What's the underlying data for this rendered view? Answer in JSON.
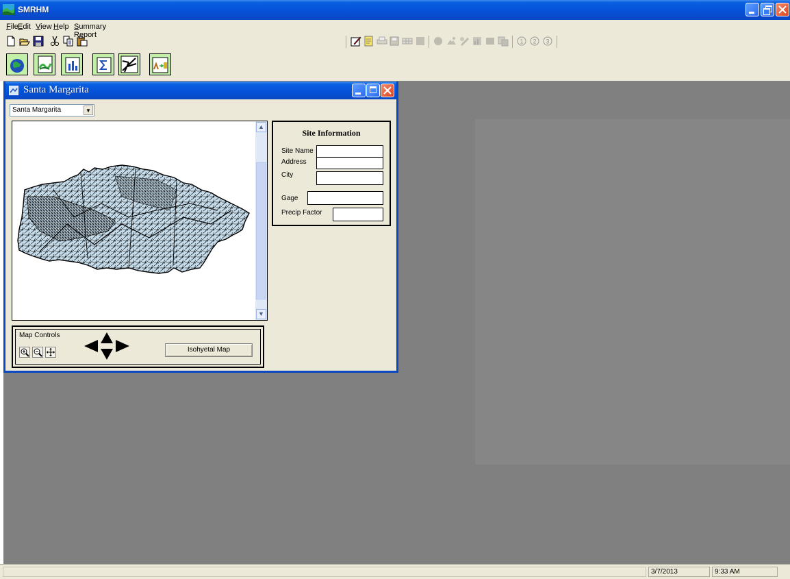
{
  "app": {
    "title": "SMRHM"
  },
  "menu": [
    {
      "label": "File",
      "mnemonic": "F"
    },
    {
      "label": "Edit",
      "mnemonic": "E"
    },
    {
      "label": "View",
      "mnemonic": "V"
    },
    {
      "label": "Help",
      "mnemonic": "H"
    },
    {
      "label": "Summary Report",
      "mnemonic": "S"
    }
  ],
  "toolbar_standard": [
    "new-icon",
    "open-icon",
    "save-icon",
    "cut-icon",
    "copy-icon",
    "paste-icon"
  ],
  "toolbar_disabled_icons": [
    "edit-icon",
    "note-icon",
    "print-icon",
    "save-icon",
    "table-icon",
    "grid-icon",
    "circle-icon",
    "layer-icon",
    "palette-icon",
    "chart-icon",
    "map-icon",
    "export-icon",
    "step-1-icon",
    "step-2-icon",
    "step-3-icon"
  ],
  "big_toolbar": [
    "globe-icon",
    "watershed-icon",
    "bar-chart-icon",
    "sigma-icon",
    "stream-network-icon",
    "hydrograph-icon"
  ],
  "child": {
    "title": "Santa Margarita",
    "select_value": "Santa Margarita",
    "site_info": {
      "title": "Site Information",
      "labels": {
        "site_name": "Site Name",
        "address": "Address",
        "city": "City",
        "gage": "Gage",
        "precip_factor": "Precip Factor"
      },
      "values": {
        "site_name": "",
        "address": "",
        "city": "",
        "gage": "",
        "precip_factor": ""
      }
    },
    "map_controls": {
      "label": "Map Controls",
      "isohyetal_button": "Isohyetal Map"
    }
  },
  "status": {
    "date": "3/7/2013",
    "time": "9:33 AM"
  },
  "colors": {
    "title_blue": "#0551d8",
    "workspace": "#808080",
    "map_fill": "#c6dcea",
    "chrome": "#ece9d8"
  }
}
